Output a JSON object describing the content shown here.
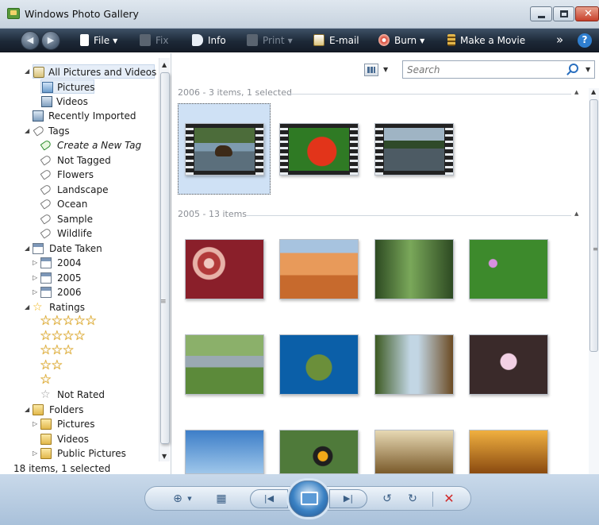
{
  "window": {
    "title": "Windows Photo Gallery"
  },
  "toolbar": {
    "file": "File",
    "fix": "Fix",
    "info": "Info",
    "print": "Print",
    "email": "E-mail",
    "burn": "Burn",
    "movie": "Make a Movie",
    "more": "»",
    "help": "?"
  },
  "sidebar": {
    "all": "All Pictures and Videos",
    "pictures": "Pictures",
    "videos": "Videos",
    "recent": "Recently Imported",
    "tags": "Tags",
    "new_tag": "Create a New Tag",
    "not_tagged": "Not Tagged",
    "tag_items": [
      "Flowers",
      "Landscape",
      "Ocean",
      "Sample",
      "Wildlife"
    ],
    "date_taken": "Date Taken",
    "years": [
      "2004",
      "2005",
      "2006"
    ],
    "ratings": "Ratings",
    "rating_levels": [
      5,
      4,
      3,
      2,
      1
    ],
    "not_rated": "Not Rated",
    "folders": "Folders",
    "folder_items": [
      "Pictures",
      "Videos",
      "Public Pictures"
    ]
  },
  "status": "18 items, 1 selected",
  "search": {
    "placeholder": "Search"
  },
  "groups": [
    {
      "label": "2006 - 3 items, 1 selected"
    },
    {
      "label": "2005 - 13 items"
    }
  ],
  "colors": {
    "toolbar": "#1d2938",
    "selection": "#cfe1f5",
    "bottom_bar": "#b9cde2",
    "delete": "#d12a2a"
  },
  "icons": [
    "back-icon",
    "forward-icon",
    "search-icon",
    "zoom-icon",
    "grid-icon",
    "previous-icon",
    "slideshow-icon",
    "next-icon",
    "rotate-left-icon",
    "rotate-right-icon",
    "delete-icon"
  ]
}
